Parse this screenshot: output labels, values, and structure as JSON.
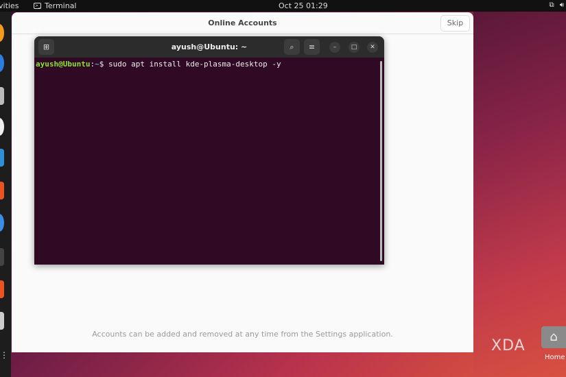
{
  "topbar": {
    "activities": "vities",
    "app": "Terminal",
    "clock": "Oct 25  01:29"
  },
  "dialog": {
    "title": "Online Accounts",
    "skip": "Skip",
    "footer": "Accounts can be added and removed at any time from the Settings application."
  },
  "terminal": {
    "title": "ayush@Ubuntu: ~",
    "prompt_user": "ayush@Ubuntu",
    "prompt_sep": ":",
    "prompt_dir": "~",
    "prompt_sym": "$ ",
    "command": "sudo apt install kde-plasma-desktop -y"
  },
  "desktop": {
    "watermark": "XDA",
    "home_label": "Home"
  },
  "colors": {
    "terminal_bg": "#300a24",
    "accent": "#e95420"
  }
}
